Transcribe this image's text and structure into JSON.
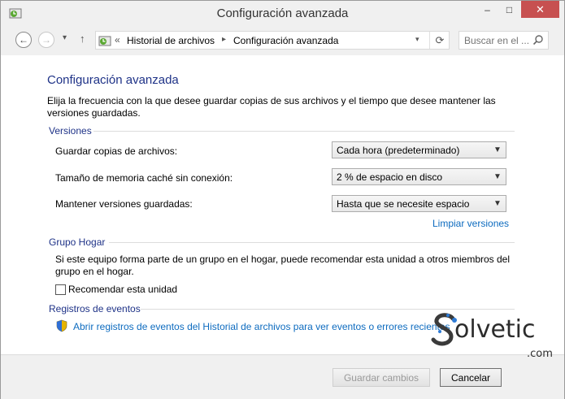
{
  "window": {
    "title": "Configuración avanzada",
    "controls": {
      "minimize": "–",
      "maximize": "□",
      "close": "✕"
    }
  },
  "nav": {
    "back": "←",
    "forward": "→",
    "history_dropdown": "▾",
    "up": "↑",
    "breadcrumb_overflow": "«",
    "breadcrumbs": [
      "Historial de archivos",
      "Configuración avanzada"
    ],
    "breadcrumb_sep": "▸",
    "address_dropdown": "▾",
    "refresh": "⟳",
    "search_placeholder": "Buscar en el ..."
  },
  "main": {
    "title": "Configuración avanzada",
    "description": "Elija la frecuencia con la que desee guardar copias de sus archivos y el tiempo que desee mantener las versiones guardadas.",
    "versions": {
      "header": "Versiones",
      "rows": [
        {
          "label": "Guardar copias de archivos:",
          "value": "Cada hora (predeterminado)"
        },
        {
          "label": "Tamaño de memoria caché sin conexión:",
          "value": "2 % de espacio en disco"
        },
        {
          "label": "Mantener versiones guardadas:",
          "value": "Hasta que se necesite espacio"
        }
      ],
      "clean_link": "Limpiar versiones"
    },
    "homegroup": {
      "header": "Grupo Hogar",
      "description": "Si este equipo forma parte de un grupo en el hogar, puede recomendar esta unidad a otros miembros del grupo en el hogar.",
      "checkbox_label": "Recomendar esta unidad",
      "checked": false
    },
    "events": {
      "header": "Registros de eventos",
      "link": "Abrir registros de eventos del Historial de archivos para ver eventos o errores recientes"
    }
  },
  "footer": {
    "save_label": "Guardar cambios",
    "save_disabled": true,
    "cancel_label": "Cancelar"
  },
  "watermark": {
    "text": "olvetic",
    "suffix": ".com"
  },
  "colors": {
    "heading": "#1e3287",
    "link": "#0d6bbf",
    "close_button": "#c75050",
    "chrome": "#f0f0f0"
  }
}
